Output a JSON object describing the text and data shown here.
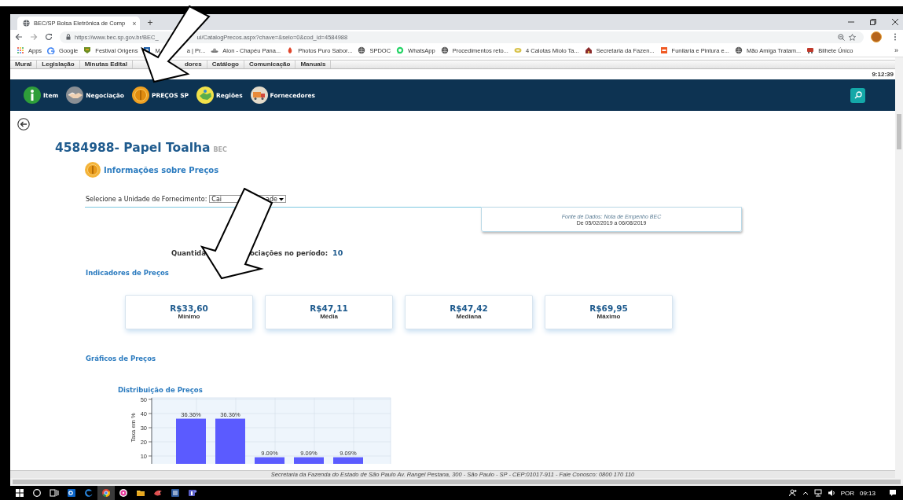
{
  "browser": {
    "tab": {
      "title": "BEC/SP Bolsa Eletrônica de Comp",
      "close": "×"
    },
    "new_tab": "+",
    "url_parts": [
      "https://www.bec.sp.gov.br/BEC_",
      "ui/CatalogPrecos.aspx?chave=&selo=0&cod_id=4584988"
    ],
    "bookmarks": [
      {
        "kind": "apps",
        "parts": [
          "Apps"
        ]
      },
      {
        "kind": "google",
        "parts": [
          "Google"
        ]
      },
      {
        "kind": "badge",
        "parts": [
          "Festival Origens"
        ]
      },
      {
        "kind": "photo",
        "parts": [
          "M",
          "a | Pr..."
        ]
      },
      {
        "kind": "hat",
        "parts": [
          "Alon - Chapéu Pana..."
        ]
      },
      {
        "kind": "leaf",
        "parts": [
          "Photos Puro Sabor..."
        ]
      },
      {
        "kind": "globe",
        "parts": [
          "SPDOC"
        ]
      },
      {
        "kind": "chat",
        "parts": [
          "WhatsApp"
        ]
      },
      {
        "kind": "globe",
        "parts": [
          "Procedimentos reto..."
        ]
      },
      {
        "kind": "ring",
        "parts": [
          "4 Calotas Miolo Ta..."
        ]
      },
      {
        "kind": "house",
        "parts": [
          "Secretaria da Fazen..."
        ]
      },
      {
        "kind": "flag",
        "parts": [
          "Funilaria e Pintura e..."
        ]
      },
      {
        "kind": "globe",
        "parts": [
          "Mão Amiga Tratam..."
        ]
      },
      {
        "kind": "bus",
        "parts": [
          "Bilhete Único"
        ]
      }
    ],
    "more": "»"
  },
  "site_menu": [
    "Mural",
    "Legislação",
    "Minutas Edital",
    "dores",
    "Catálogo",
    "Comunicação",
    "Manuais"
  ],
  "clock": "9:12:39",
  "nav": [
    {
      "label": "Item",
      "kind": "info"
    },
    {
      "label": "Negociação",
      "kind": "handshake"
    },
    {
      "label": "PREÇOS SP",
      "kind": "coin"
    },
    {
      "label": "Regiões",
      "kind": "map"
    },
    {
      "label": "Fornecedores",
      "kind": "truck"
    }
  ],
  "product": {
    "title": "4584988- Papel Toalha",
    "tag": "BEC"
  },
  "section": "Informações sobre Preços",
  "unit_select": {
    "label": "Selecione a Unidade de Fornecimento:",
    "value_parts": [
      "Cai",
      "ade"
    ]
  },
  "source": {
    "caption": "Fonte de Dados: Nota de Empenho BEC",
    "period": "De 05/02/2019 a 06/08/2019"
  },
  "count": {
    "label_parts": [
      "Quantida",
      "ociações no período:"
    ],
    "value": "10"
  },
  "indicators": {
    "title": "Indicadores de Preços",
    "cards": [
      {
        "value": "R$33,60",
        "label": "Mínimo"
      },
      {
        "value": "R$47,11",
        "label": "Média"
      },
      {
        "value": "R$47,42",
        "label": "Mediana"
      },
      {
        "value": "R$69,95",
        "label": "Máximo"
      }
    ]
  },
  "charts": {
    "title": "Gráficos de Preços",
    "distribution": {
      "title": "Distribuição de Preços",
      "chart_data": {
        "type": "bar",
        "grid": true,
        "ylabel": "Taxa em %",
        "values": [
          36.36,
          36.36,
          9.09,
          9.09,
          9.09
        ],
        "ylim": [
          0,
          50
        ],
        "yticks": [
          10,
          20,
          30,
          40,
          50
        ],
        "value_labels": [
          "36.36%",
          "36.36%",
          "9.09%",
          "9.09%",
          "9.09%"
        ]
      }
    }
  },
  "footer": "Secretaria da Fazenda do Estado de São Paulo Av. Rangel Pestana, 300 - São Paulo - SP - CEP:01017-911 - Fale Conosco: 0800 170 110",
  "taskbar": {
    "apps": [
      {
        "kind": "start",
        "selected": false
      },
      {
        "kind": "search",
        "selected": false
      },
      {
        "kind": "taskview",
        "selected": false
      },
      {
        "kind": "mail",
        "selected": false
      },
      {
        "kind": "edge",
        "selected": false
      },
      {
        "kind": "chrome",
        "selected": true
      },
      {
        "kind": "music",
        "selected": false
      },
      {
        "kind": "folder",
        "selected": false
      },
      {
        "kind": "bird",
        "selected": false
      },
      {
        "kind": "word",
        "selected": false
      },
      {
        "kind": "teams",
        "selected": false
      }
    ],
    "language": "POR",
    "time": "09:13"
  }
}
